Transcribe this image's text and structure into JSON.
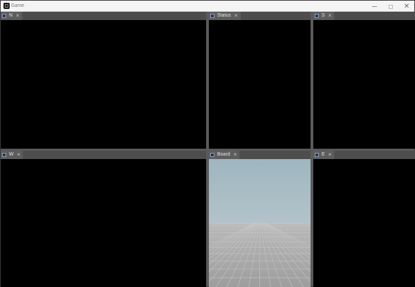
{
  "window": {
    "title": "Game",
    "icons": {
      "app": "app-icon",
      "minimize": "minimize-icon",
      "maximize": "maximize-icon",
      "close": "close-icon"
    }
  },
  "panels": [
    {
      "id": "n",
      "label": "N",
      "close_glyph": "×"
    },
    {
      "id": "status",
      "label": "Status",
      "close_glyph": "×"
    },
    {
      "id": "s",
      "label": "S",
      "close_glyph": "×"
    },
    {
      "id": "w",
      "label": "W",
      "close_glyph": "×"
    },
    {
      "id": "board",
      "label": "Board",
      "close_glyph": "×"
    },
    {
      "id": "e",
      "label": "E",
      "close_glyph": "×"
    }
  ],
  "colors": {
    "panel_body": "#000000",
    "tab_bg": "#5d5d5d",
    "header_bg": "#4d4d4d",
    "sky_top": "#9fb6c0",
    "floor": "#a9a9a9"
  }
}
